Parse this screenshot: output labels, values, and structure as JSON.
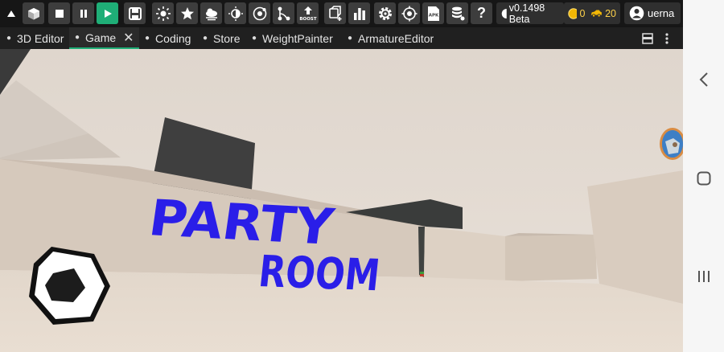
{
  "toolbar": {
    "buttons": [
      {
        "icon": "caret-up-icon"
      },
      {
        "icon": "cube-icon"
      },
      {
        "icon": "stop-icon"
      },
      {
        "icon": "pause-icon"
      },
      {
        "icon": "play-icon"
      },
      {
        "icon": "save-icon"
      },
      {
        "icon": "sun-settings-icon"
      },
      {
        "icon": "star-icon"
      },
      {
        "icon": "weather-icon"
      },
      {
        "icon": "lighting-icon"
      },
      {
        "icon": "physics-icon"
      },
      {
        "icon": "node-graph-icon"
      },
      {
        "icon": "boost-icon"
      },
      {
        "icon": "add-object-icon"
      },
      {
        "icon": "stats-icon"
      },
      {
        "icon": "settings-icon"
      },
      {
        "icon": "target-icon"
      },
      {
        "icon": "apk-icon"
      },
      {
        "icon": "database-icon"
      },
      {
        "icon": "help-icon"
      }
    ],
    "version": "v0.1498 Beta",
    "coins": "0",
    "cars": "20",
    "username": "uerna",
    "boost_label": "BOOST",
    "apk_label": "APK",
    "help_label": "?",
    "colors": {
      "play": "#1fae77",
      "button": "#3d3d3d",
      "coin": "#ffd24a"
    }
  },
  "tabs": [
    {
      "label": "3D Editor",
      "active": false
    },
    {
      "label": "Game",
      "active": true,
      "closable": true
    },
    {
      "label": "Coding",
      "active": false
    },
    {
      "label": "Store",
      "active": false
    },
    {
      "label": "WeightPainter",
      "active": false
    },
    {
      "label": "ArmatureEditor",
      "active": false
    }
  ],
  "tab_close_glyph": "✕",
  "scene": {
    "wall_text_line1": "PARTY",
    "wall_text_line2": "ROOM",
    "wall_text_color": "#2a1ee8"
  },
  "android_nav": [
    {
      "icon": "back-icon"
    },
    {
      "icon": "home-icon"
    },
    {
      "icon": "recents-icon"
    }
  ]
}
